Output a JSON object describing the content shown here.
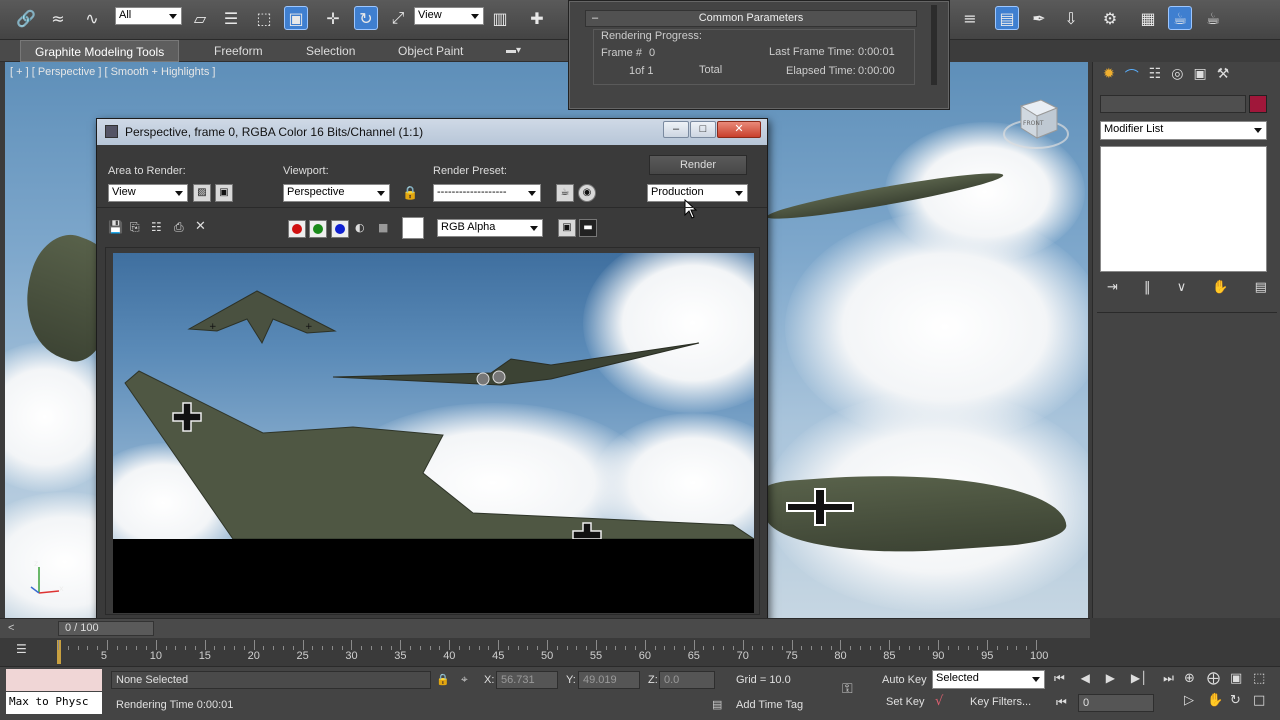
{
  "toolbar": {
    "selection_filter": "All",
    "ref_coord": "View",
    "icons": [
      "link-icon",
      "unlink-icon",
      "bind-space-warp-icon",
      "select-icon",
      "select-by-name-icon",
      "region-select-icon",
      "window-crossing-icon",
      "move-icon",
      "rotate-icon",
      "scale-icon",
      "pivot-icon",
      "snap-icon",
      "layer-manager-icon",
      "schematic-view-icon",
      "material-editor-icon",
      "render-setup-icon",
      "rendered-frame-window-icon",
      "render-icon",
      "teapot-icon"
    ]
  },
  "ribbon": {
    "tabs": [
      "Graphite Modeling Tools",
      "Freeform",
      "Selection",
      "Object Paint"
    ]
  },
  "viewport": {
    "label": "[ + ] [ Perspective ] [ Smooth + Highlights ]",
    "axis_z": "z",
    "axis_x": "x",
    "axis_y": "y",
    "viewcube_label": "FRONT"
  },
  "render_progress": {
    "header": "Common Parameters",
    "section": "Rendering Progress:",
    "frame_label": "Frame #",
    "frame_value": "0",
    "of_label": "1of 1",
    "total_label": "Total",
    "last_frame_label": "Last Frame Time:",
    "last_frame_value": "0:00:01",
    "elapsed_label": "Elapsed Time:",
    "elapsed_value": "0:00:00"
  },
  "frame_buffer": {
    "title": "Perspective, frame 0, RGBA Color 16 Bits/Channel (1:1)",
    "area_label": "Area to Render:",
    "area_value": "View",
    "viewport_label": "Viewport:",
    "viewport_value": "Perspective",
    "preset_label": "Render Preset:",
    "preset_value": "-------------------",
    "render_button": "Render",
    "production_value": "Production",
    "channel_value": "RGB Alpha",
    "colors": {
      "red": "#d01010",
      "green": "#1a8a1a",
      "blue": "#1020d0"
    }
  },
  "command_panel": {
    "modifier_list": "Modifier List",
    "color_swatch": "#a0173a"
  },
  "timeline": {
    "frame_counter": "0 / 100",
    "ticks": [
      "5",
      "10",
      "15",
      "20",
      "25",
      "30",
      "35",
      "40",
      "45",
      "50",
      "55",
      "60",
      "65",
      "70",
      "75",
      "80",
      "85",
      "90",
      "95",
      "100"
    ]
  },
  "status": {
    "script_prompt": "Max to Physc",
    "selection_status": "None Selected",
    "render_time": "Rendering Time  0:00:01",
    "x_label": "X:",
    "x_value": "56.731",
    "y_label": "Y:",
    "y_value": "49.019",
    "z_label": "Z:",
    "z_value": "0.0",
    "grid": "Grid = 10.0",
    "add_time_tag": "Add Time Tag",
    "auto_key": "Auto Key",
    "set_key": "Set Key",
    "key_mode": "Selected",
    "key_filters": "Key Filters...",
    "current_frame": "0"
  }
}
